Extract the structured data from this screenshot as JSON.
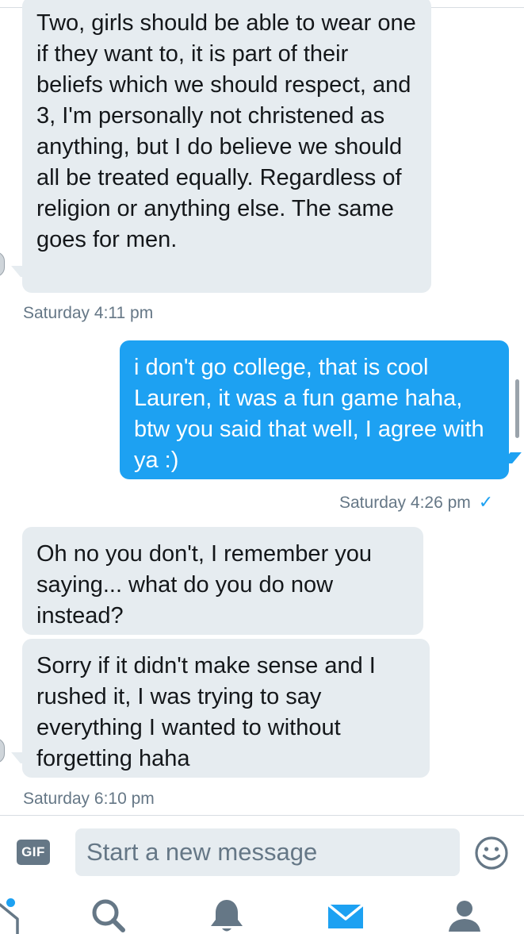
{
  "conversation": {
    "messages": [
      {
        "direction": "incoming",
        "text": "Two, girls should be able to wear one if they want to, it is part of their beliefs which we should respect, and 3, I'm personally not christened as anything, but I do believe we should all be treated equally. Regardless of religion or anything else. The same goes for men."
      },
      {
        "direction": "outgoing",
        "text": "i don't go college, that is cool Lauren, it was a fun game haha, btw you said that well, I agree with ya :)"
      },
      {
        "direction": "incoming",
        "text": "Oh no you don't, I remember you saying... what do you do now instead?"
      },
      {
        "direction": "incoming",
        "text": "Sorry if it didn't make sense and I rushed it, I was trying to say everything I wanted to without forgetting haha"
      }
    ],
    "timestamps": [
      "Saturday 4:11 pm",
      "Saturday 4:26 pm",
      "Saturday 6:10 pm"
    ],
    "read_indicator": "✓"
  },
  "composer": {
    "gif_label": "GIF",
    "placeholder": "Start a new message",
    "value": ""
  },
  "icons": {
    "emoji": "smiley-icon",
    "gif": "gif-icon"
  },
  "tabbar": {
    "items": [
      {
        "name": "home",
        "icon": "home-icon"
      },
      {
        "name": "search",
        "icon": "search-icon"
      },
      {
        "name": "notifications",
        "icon": "bell-icon"
      },
      {
        "name": "messages",
        "icon": "envelope-icon",
        "active": true
      },
      {
        "name": "profile",
        "icon": "person-icon"
      }
    ]
  },
  "colors": {
    "accent": "#1da1f2",
    "incoming_bubble": "#e6ecf0",
    "muted_text": "#657786",
    "inactive_icon": "#657786"
  }
}
